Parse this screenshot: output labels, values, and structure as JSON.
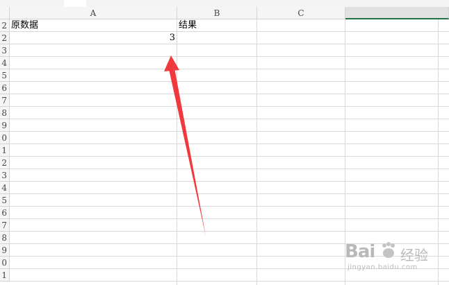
{
  "columns": [
    "A",
    "B",
    "C"
  ],
  "rows": [
    "2",
    "2",
    "3",
    "4",
    "5",
    "6",
    "7",
    "8",
    "9",
    "0",
    "1",
    "2",
    "3",
    "4",
    "5",
    "6",
    "7",
    "8",
    "9",
    "0",
    "1"
  ],
  "cells": {
    "a1": "原数据",
    "b1": "结果",
    "a2": "3"
  },
  "watermark": {
    "brand": "Bai",
    "brand_suffix": "经验",
    "url": "jingyan.baidu.com"
  },
  "colors": {
    "arrow": "#f0393c",
    "selected_column_underline": "#217346"
  }
}
